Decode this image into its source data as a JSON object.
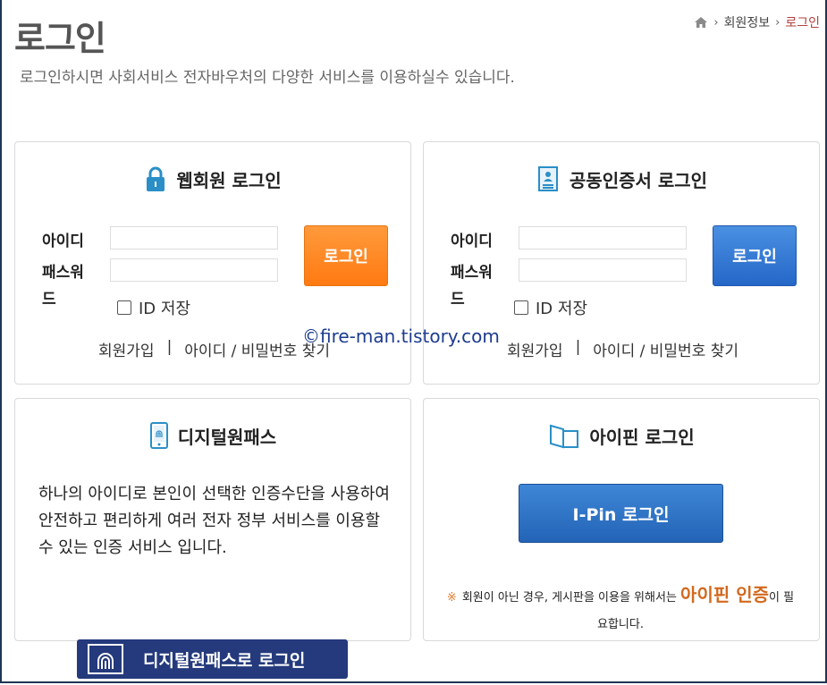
{
  "header": {
    "title": "로그인",
    "subtitle": "로그인하시면 사회서비스 전자바우처의 다양한 서비스를 이용하실수 있습니다.",
    "breadcrumb": [
      "회원정보",
      "로그인"
    ]
  },
  "web_login": {
    "title": "웹회원 로그인",
    "id_label": "아이디",
    "pw_label": "패스워드",
    "login_button": "로그인",
    "remember_label": "ID 저장",
    "join_link": "회원가입",
    "divider": "|",
    "find_link": "아이디 / 비밀번호 찾기"
  },
  "cert_login": {
    "title": "공동인증서 로그인",
    "id_label": "아이디",
    "pw_label": "패스워드",
    "login_button": "로그인",
    "remember_label": "ID 저장",
    "join_link": "회원가입",
    "divider": "|",
    "find_link": "아이디 / 비밀번호 찾기"
  },
  "digital_pass": {
    "title": "디지털원패스",
    "description": "하나의 아이디로 본인이 선택한 인증수단을 사용하여 안전하고 편리하게 여러 전자 정부 서비스를 이용할 수 있는 인증 서비스 입니다.",
    "login_button": "디지털원패스로 로그인"
  },
  "ipin": {
    "title": "아이핀 로그인",
    "login_button": "I-Pin 로그인",
    "notice_mark": "※",
    "notice_prefix": "회원이 아닌 경우, 게시판을 이용을 위해서는 ",
    "notice_strong": "아이핀 인증",
    "notice_suffix": "이 필요합니다."
  },
  "watermark": "©fire-man.tistory.com",
  "colors": {
    "orange_button": "#ff8a20",
    "blue_button": "#2f76d0",
    "navy_button": "#253a7c",
    "accent_text": "#d2691e",
    "breadcrumb_current": "#b0413e"
  }
}
